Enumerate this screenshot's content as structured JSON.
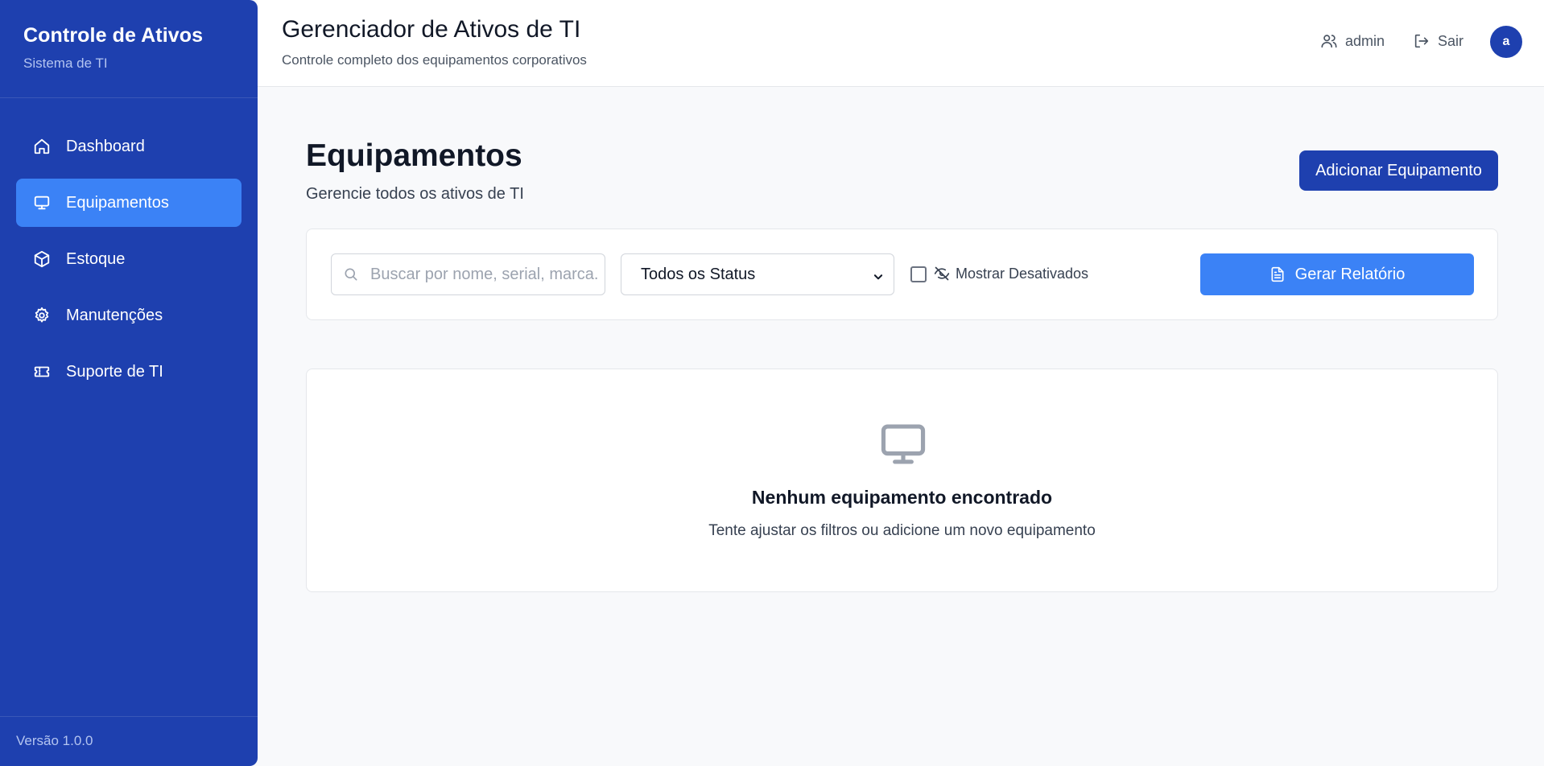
{
  "sidebar": {
    "brand_title": "Controle de Ativos",
    "brand_subtitle": "Sistema de TI",
    "items": [
      {
        "label": "Dashboard",
        "icon": "home-icon",
        "active": false
      },
      {
        "label": "Equipamentos",
        "icon": "monitor-icon",
        "active": true
      },
      {
        "label": "Estoque",
        "icon": "package-icon",
        "active": false
      },
      {
        "label": "Manutenções",
        "icon": "gear-icon",
        "active": false
      },
      {
        "label": "Suporte de TI",
        "icon": "ticket-icon",
        "active": false
      }
    ],
    "version": "Versão 1.0.0",
    "bg_color": "#1e40af",
    "active_color": "#3b82f6"
  },
  "header": {
    "title": "Gerenciador de Ativos de TI",
    "subtitle": "Controle completo dos equipamentos corporativos",
    "user_label": "admin",
    "logout_label": "Sair",
    "avatar_initial": "a"
  },
  "main": {
    "title": "Equipamentos",
    "subtitle": "Gerencie todos os ativos de TI",
    "add_button": "Adicionar Equipamento",
    "filters": {
      "search_placeholder": "Buscar por nome, serial, marca...",
      "search_value": "",
      "status_selected": "Todos os Status",
      "show_disabled_label": "Mostrar Desativados",
      "show_disabled_checked": false,
      "report_button": "Gerar Relatório"
    },
    "empty_state": {
      "icon": "monitor-icon",
      "title": "Nenhum equipamento encontrado",
      "subtitle": "Tente ajustar os filtros ou adicione um novo equipamento"
    }
  }
}
